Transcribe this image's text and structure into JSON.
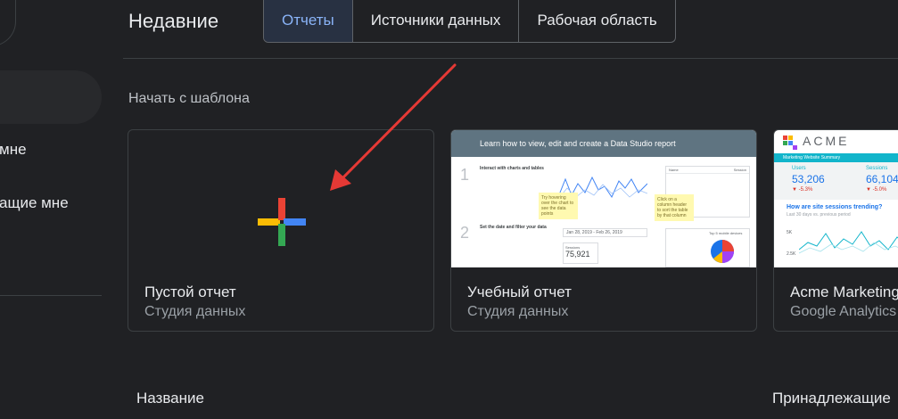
{
  "sidebar": {
    "items": [
      {
        "label": "мне"
      },
      {
        "label": "ащие мне"
      }
    ]
  },
  "header": {
    "title": "Недавние",
    "tabs": [
      {
        "label": "Отчеты",
        "active": true
      },
      {
        "label": "Источники данных",
        "active": false
      },
      {
        "label": "Рабочая область",
        "active": false
      }
    ]
  },
  "templates": {
    "section_title": "Начать с шаблона",
    "cards": [
      {
        "title": "Пустой отчет",
        "subtitle": "Студия данных"
      },
      {
        "title": "Учебный отчет",
        "subtitle": "Студия данных",
        "thumbnail": {
          "heading": "Learn how to view, edit and create a Data Studio report",
          "step1_title": "Interact with charts and tables",
          "step2_title": "Set the date and filter your data",
          "note1": "Try hovering over the chart to see the data points",
          "note2": "Click on a column header to sort the table by that column",
          "date_range": "Jan 28, 2019 - Feb 26, 2019",
          "sessions_label": "Sessions",
          "sessions_value": "75,921",
          "mobile_label": "Top 5 mobile devices",
          "table_header": [
            "Name",
            "Session"
          ]
        }
      },
      {
        "title": "Acme Marketing",
        "subtitle": "Google Analytics",
        "thumbnail": {
          "logo": "ACME",
          "band": "Marketing Website Summary",
          "metric1_label": "Users",
          "metric1_value": "53,206",
          "metric1_change": "▼ -5.3%",
          "metric2_label": "Sessions",
          "metric2_value": "66,104",
          "metric2_change": "▼ -5.0%",
          "question": "How are site sessions trending?",
          "question_sub": "Last 30 days vs. previous period",
          "axis1": "5K",
          "axis2": "2.5K"
        }
      }
    ]
  },
  "list": {
    "col_name": "Название",
    "col_owner": "Принадлежащие"
  },
  "colors": {
    "background": "#202124",
    "accent": "#8ab4f8",
    "annotation_arrow": "#e53935"
  }
}
